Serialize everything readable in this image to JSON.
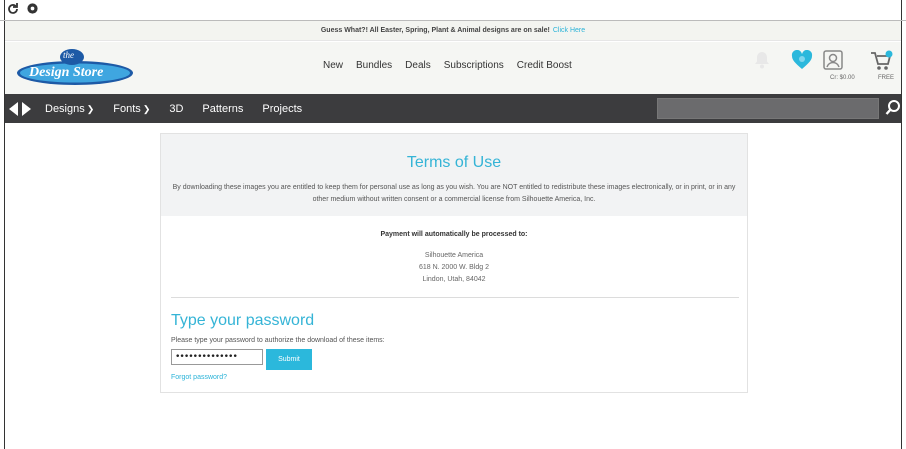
{
  "promo": {
    "text": "Guess What?! All Easter, Spring, Plant & Animal designs are on sale!",
    "link": "Click Here"
  },
  "header": {
    "logo_text": "Design Store",
    "logo_small": "the",
    "nav": [
      "New",
      "Bundles",
      "Deals",
      "Subscriptions",
      "Credit Boost"
    ],
    "account_label": "Cr: $0.00",
    "cart_label": "FREE"
  },
  "catbar": {
    "items": [
      {
        "label": "Designs",
        "chevron": true
      },
      {
        "label": "Fonts",
        "chevron": true
      },
      {
        "label": "3D",
        "chevron": false
      },
      {
        "label": "Patterns",
        "chevron": false
      },
      {
        "label": "Projects",
        "chevron": false
      }
    ],
    "search_placeholder": ""
  },
  "terms": {
    "title": "Terms of Use",
    "body": "By downloading these images you are entitled to keep them for personal use as long as you wish. You are NOT entitled to redistribute these images electronically, or in print, or in any other medium without written consent or a commercial license from Silhouette America, Inc."
  },
  "payment": {
    "heading": "Payment will automatically be processed to:",
    "address": [
      "Silhouette America",
      "618 N. 2000 W. Bldg 2",
      "Lindon, Utah, 84042"
    ]
  },
  "password": {
    "title": "Type your password",
    "description": "Please type your password to authorize the download of these items:",
    "value": "••••••••••••••",
    "submit": "Submit",
    "forgot": "Forgot password?"
  },
  "colors": {
    "accent": "#2bb8dc",
    "catbar": "#3c3c3e"
  },
  "icons": [
    "refresh-icon",
    "settings-icon",
    "bell-icon",
    "heart-icon",
    "user-icon",
    "cart-icon",
    "search-icon"
  ]
}
